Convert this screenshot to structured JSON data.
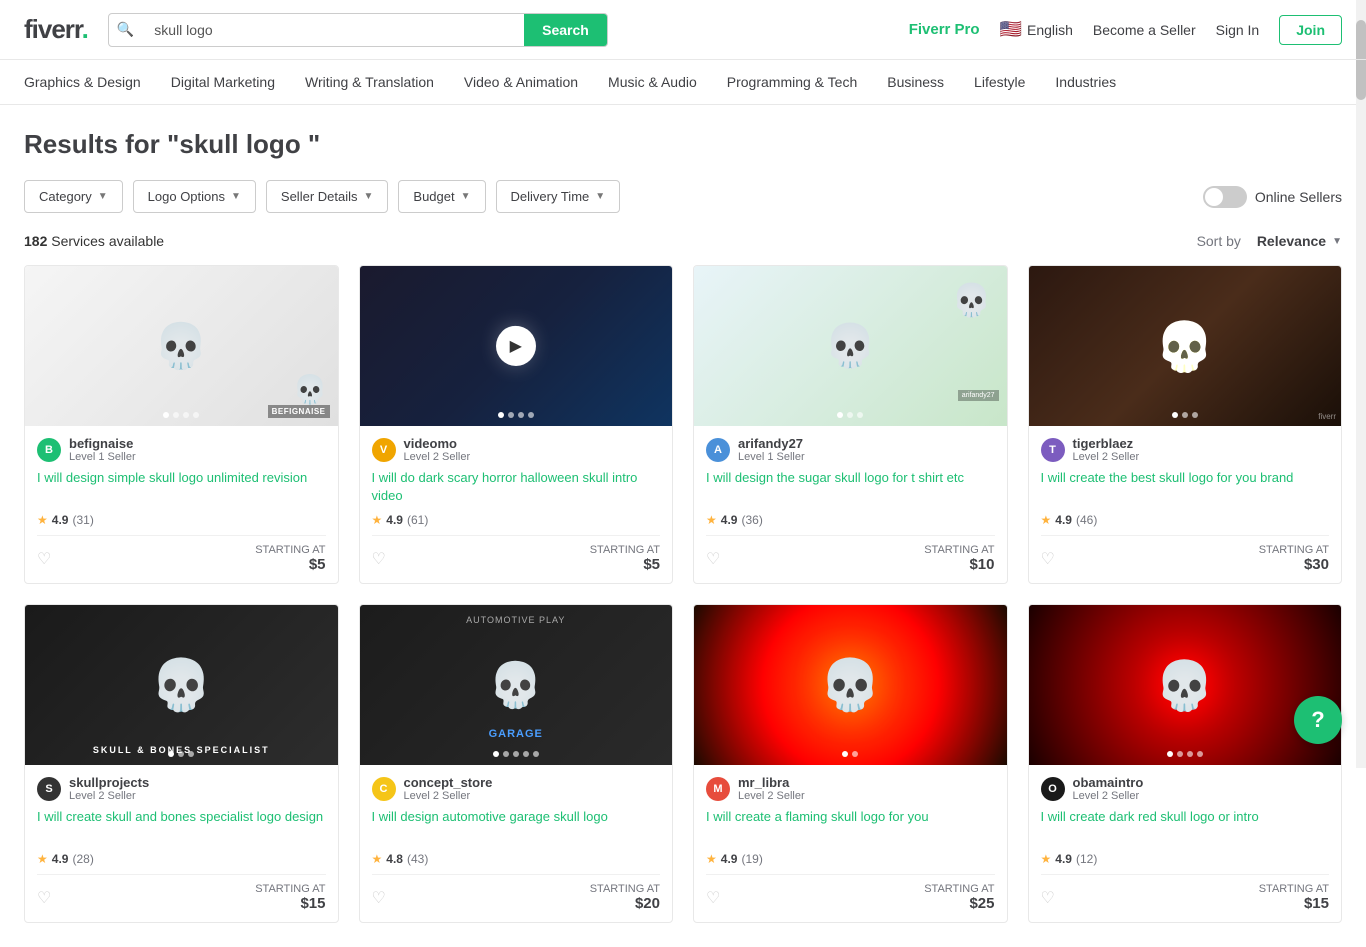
{
  "header": {
    "logo_text": "fiverr",
    "search_placeholder": "skull logo",
    "search_button": "Search",
    "fiverr_pro": "Fiverr Pro",
    "language": "English",
    "become_seller": "Become a Seller",
    "sign_in": "Sign In",
    "join": "Join"
  },
  "nav": {
    "items": [
      {
        "id": "graphics",
        "label": "Graphics & Design"
      },
      {
        "id": "digital",
        "label": "Digital Marketing"
      },
      {
        "id": "writing",
        "label": "Writing & Translation"
      },
      {
        "id": "video",
        "label": "Video & Animation"
      },
      {
        "id": "music",
        "label": "Music & Audio"
      },
      {
        "id": "programming",
        "label": "Programming & Tech"
      },
      {
        "id": "business",
        "label": "Business"
      },
      {
        "id": "lifestyle",
        "label": "Lifestyle"
      },
      {
        "id": "industries",
        "label": "Industries"
      }
    ]
  },
  "results": {
    "title": "Results for \"skull logo \"",
    "count": "182",
    "count_label": "Services available",
    "sort_prefix": "Sort by",
    "sort_value": "Relevance"
  },
  "filters": {
    "category_label": "Category",
    "logo_options_label": "Logo Options",
    "seller_details_label": "Seller Details",
    "budget_label": "Budget",
    "delivery_time_label": "Delivery Time",
    "online_sellers_label": "Online Sellers"
  },
  "cards": [
    {
      "id": "card1",
      "seller_name": "befignaise",
      "seller_level": "Level 1 Seller",
      "title": "I will design simple skull logo unlimited revision",
      "rating": "4.9",
      "reviews": "31",
      "price": "$5",
      "starting_at": "STARTING AT",
      "image_class": "skull1",
      "av_class": "av-teal",
      "av_text": "B"
    },
    {
      "id": "card2",
      "seller_name": "videomo",
      "seller_level": "Level 2 Seller",
      "title": "I will do dark scary horror halloween skull intro video",
      "rating": "4.9",
      "reviews": "61",
      "price": "$5",
      "starting_at": "STARTING AT",
      "image_class": "skull2",
      "av_class": "av-orange",
      "av_text": "V",
      "has_play": true
    },
    {
      "id": "card3",
      "seller_name": "arifandy27",
      "seller_level": "Level 1 Seller",
      "title": "I will design the sugar skull logo for t shirt etc",
      "rating": "4.9",
      "reviews": "36",
      "price": "$10",
      "starting_at": "STARTING AT",
      "image_class": "skull3",
      "av_class": "av-blue",
      "av_text": "A"
    },
    {
      "id": "card4",
      "seller_name": "tigerblaez",
      "seller_level": "Level 2 Seller",
      "title": "I will create the best skull logo for you brand",
      "rating": "4.9",
      "reviews": "46",
      "price": "$30",
      "starting_at": "STARTING AT",
      "image_class": "skull4",
      "av_class": "av-purple",
      "av_text": "T"
    },
    {
      "id": "card5",
      "seller_name": "skullprojects",
      "seller_level": "Level 2 Seller",
      "title": "I will create skull and bones specialist logo design",
      "rating": "4.9",
      "reviews": "28",
      "price": "$15",
      "starting_at": "STARTING AT",
      "image_class": "skull5",
      "av_class": "av-dark",
      "av_text": "S"
    },
    {
      "id": "card6",
      "seller_name": "concept_store",
      "seller_level": "Level 2 Seller",
      "title": "I will design automotive garage skull logo",
      "rating": "4.8",
      "reviews": "43",
      "price": "$20",
      "starting_at": "STARTING AT",
      "image_class": "skull6",
      "av_class": "av-yellow",
      "av_text": "C"
    },
    {
      "id": "card7",
      "seller_name": "mr_libra",
      "seller_level": "Level 2 Seller",
      "title": "I will create a flaming skull logo for you",
      "rating": "4.9",
      "reviews": "19",
      "price": "$25",
      "starting_at": "STARTING AT",
      "image_class": "skull7",
      "av_class": "av-red",
      "av_text": "M"
    },
    {
      "id": "card8",
      "seller_name": "obamaintro",
      "seller_level": "Level 2 Seller",
      "title": "I will create dark red skull logo or intro",
      "rating": "4.9",
      "reviews": "12",
      "price": "$15",
      "starting_at": "STARTING AT",
      "image_class": "skull8",
      "av_class": "av-black",
      "av_text": "O"
    }
  ]
}
